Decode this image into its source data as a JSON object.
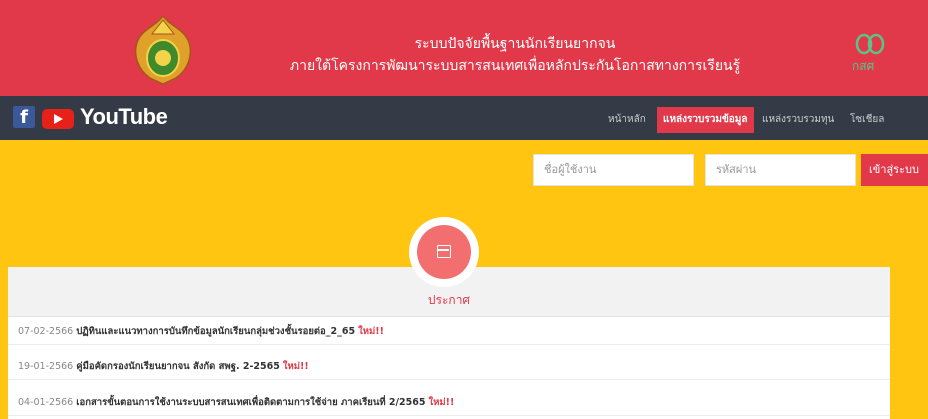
{
  "header": {
    "title": "ระบบปัจจัยพื้นฐานนักเรียนยากจน",
    "subtitle": "ภายใต้โครงการพัฒนาระบบสารสนเทศเพื่อหลักประกันโอกาสทางการเรียนรู้",
    "right_logo_text": "กสศ",
    "seal_icon": "ministry-seal",
    "accent_color": "#e2394a"
  },
  "nav": {
    "youtube_label": "YouTube",
    "items": [
      "หน้าหลัก",
      "แหล่งรวบรวมข้อมูล",
      "แหล่งรวบรวมทุน",
      "โซเชียล"
    ],
    "active_index": 1
  },
  "login": {
    "username_placeholder": "ชื่อผู้ใช้งาน",
    "password_placeholder": "รหัสผ่าน",
    "submit_label": "เข้าสู่ระบบ"
  },
  "announcements": {
    "title": "ประกาศ",
    "items": [
      {
        "date": "07-02-2566",
        "text": "ปฏิทินและแนวทางการบันทึกข้อมูลนักเรียนกลุ่มช่วงชั้นรอยต่อ_2_65",
        "badge": "ใหม่!!"
      },
      {
        "date": "19-01-2566",
        "text": "คู่มือคัดกรองนักเรียนยากจน สังกัด สพฐ. 2-2565",
        "badge": "ใหม่!!"
      },
      {
        "date": "04-01-2566",
        "text": "เอกสารขั้นตอนการใช้งานระบบสารสนเทศเพื่อติดตามการใช้จ่าย ภาคเรียนที่ 2/2565",
        "badge": "ใหม่!!"
      }
    ]
  }
}
